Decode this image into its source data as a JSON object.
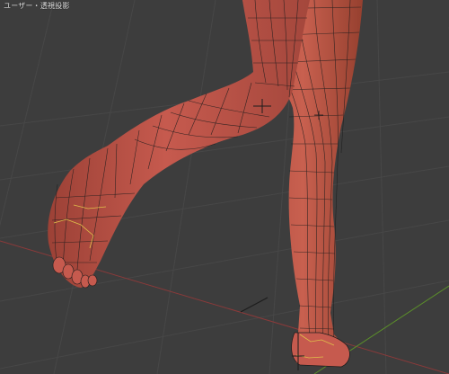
{
  "viewport": {
    "label": "ユーザー・透視投影",
    "background_color": "#3d3d3d",
    "grid_color": "#474747",
    "x_axis_color": "#8a3a3a",
    "y_axis_color": "#5b8f2a",
    "mesh_color": "#c65a4e",
    "mesh_shade_color": "#8f3b33",
    "wire_color": "#1c1c1c",
    "selected_edge_color": "#e0c04a",
    "empty_object": "empty-axes"
  }
}
